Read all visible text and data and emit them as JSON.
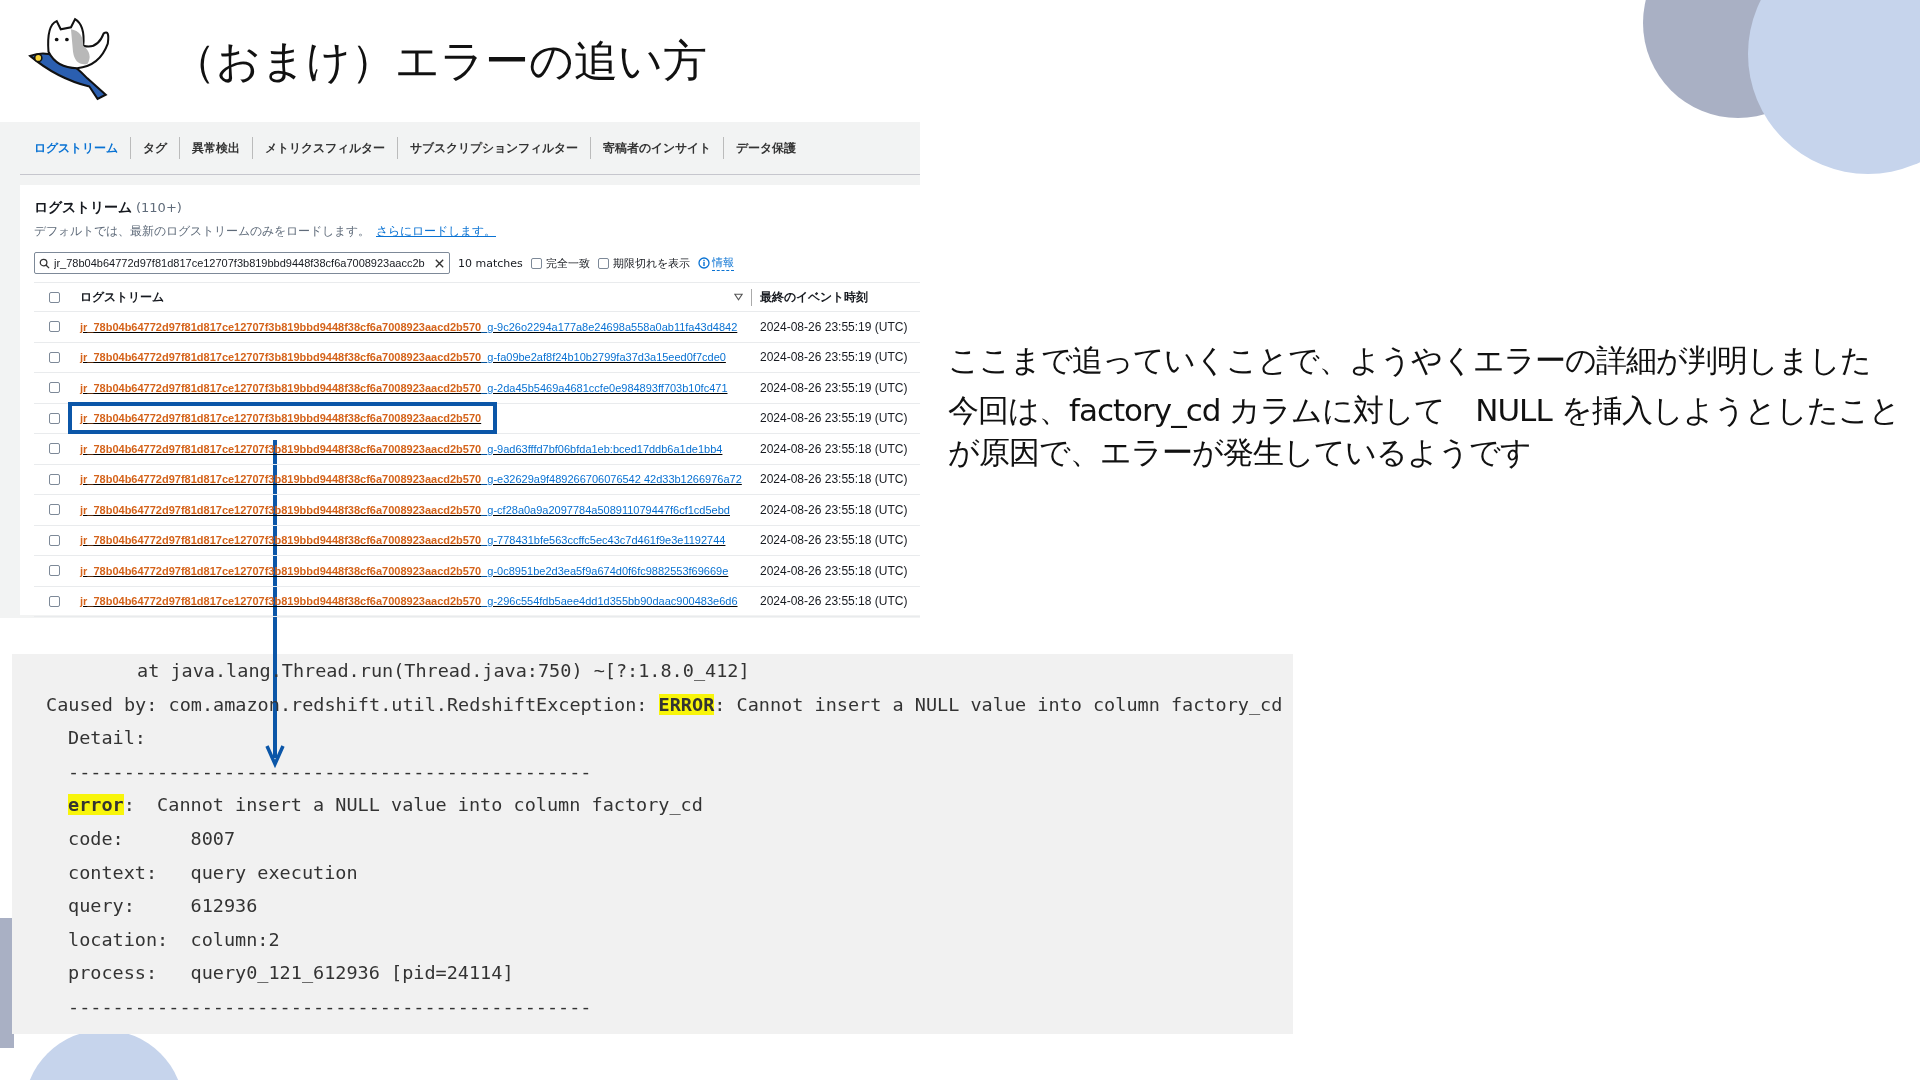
{
  "slide": {
    "title": "（おまけ）エラーの追い方"
  },
  "console": {
    "tabs": [
      {
        "label": "ログストリーム",
        "selected": true
      },
      {
        "label": "タグ",
        "selected": false
      },
      {
        "label": "異常検出",
        "selected": false
      },
      {
        "label": "メトリクスフィルター",
        "selected": false
      },
      {
        "label": "サブスクリプションフィルター",
        "selected": false
      },
      {
        "label": "寄稿者のインサイト",
        "selected": false
      },
      {
        "label": "データ保護",
        "selected": false
      }
    ],
    "panel_title": "ログストリーム",
    "count": "(110+)",
    "description": "デフォルトでは、最新のログストリームのみをロードします。",
    "load_more_link": "さらにロードします。",
    "search": {
      "value": "jr_78b04b64772d97f81d817ce12707f3b819bbd9448f38cf6a7008923aacc2b"
    },
    "matches": "10 matches",
    "options": [
      {
        "label": "完全一致",
        "checked": false
      },
      {
        "label": "期限切れを表示",
        "checked": false
      }
    ],
    "info_link": "情報",
    "select_all_checked": false,
    "columns": [
      "ログストリーム",
      "最終のイベント時刻"
    ],
    "rows": [
      {
        "prefix": "jr_78b04b64772d97f81d817ce12707f3b819bbd9448f38cf6a7008923aacd2b570",
        "suffix": "_g-9c26o2294a177a8e24698a558a0ab11fa43d4842",
        "time": "2024-08-26 23:55:19 (UTC)",
        "checked": false,
        "highlighted": false
      },
      {
        "prefix": "jr_78b04b64772d97f81d817ce12707f3b819bbd9448f38cf6a7008923aacd2b570",
        "suffix": "_g-fa09be2af8f24b10b2799fa37d3a15eed0f7cde0",
        "time": "2024-08-26 23:55:19 (UTC)",
        "checked": false,
        "highlighted": false
      },
      {
        "prefix": "jr_78b04b64772d97f81d817ce12707f3b819bbd9448f38cf6a7008923aacd2b570",
        "suffix": "_g-2da45b5469a4681ccfe0e984893ff703b10fc471",
        "time": "2024-08-26 23:55:19 (UTC)",
        "checked": false,
        "highlighted": false
      },
      {
        "prefix": "jr_78b04b64772d97f81d817ce12707f3b819bbd9448f38cf6a7008923aacd2b570",
        "time": "2024-08-26 23:55:19 (UTC)",
        "checked": false,
        "highlighted": true
      },
      {
        "prefix": "jr_78b04b64772d97f81d817ce12707f3b819bbd9448f38cf6a7008923aacd2b570",
        "suffix": "_g-9ad63fffd7bf06bfda1eb:bced17ddb6a1de1bb4",
        "time": "2024-08-26 23:55:18 (UTC)",
        "checked": false,
        "highlighted": false
      },
      {
        "prefix": "jr_78b04b64772d97f81d817ce12707f3b819bbd9448f38cf6a7008923aacd2b570",
        "suffix": "_g-e32629a9f489266706076542 42d33b1266976a72",
        "time": "2024-08-26 23:55:18 (UTC)",
        "checked": false,
        "highlighted": false
      },
      {
        "prefix": "jr_78b04b64772d97f81d817ce12707f3b819bbd9448f38cf6a7008923aacd2b570",
        "suffix": "_g-cf28a0a9a2097784a508911079447f6cf1cd5ebd",
        "time": "2024-08-26 23:55:18 (UTC)",
        "checked": false,
        "highlighted": false
      },
      {
        "prefix": "jr_78b04b64772d97f81d817ce12707f3b819bbd9448f38cf6a7008923aacd2b570",
        "suffix": "_g-778431bfe563ccffc5ec43c7d461f9e3e1192744",
        "time": "2024-08-26 23:55:18 (UTC)",
        "checked": false,
        "highlighted": false
      },
      {
        "prefix": "jr_78b04b64772d97f81d817ce12707f3b819bbd9448f38cf6a7008923aacd2b570",
        "suffix": "_g-0c8951be2d3ea5f9a674d0f6fc9882553f69669e",
        "time": "2024-08-26 23:55:18 (UTC)",
        "checked": false,
        "highlighted": false
      },
      {
        "prefix": "jr_78b04b64772d97f81d817ce12707f3b819bbd9448f38cf6a7008923aacd2b570",
        "suffix": "_g-296c554fdb5aee4dd1d355bb90daac900483e6d6",
        "time": "2024-08-26 23:55:18 (UTC)",
        "checked": false,
        "highlighted": false
      }
    ]
  },
  "explanation": [
    "ここまで追っていくことで、ようやくエラーの詳細が判明しました",
    "今回は、factory_cd カラムに対して　NULL を挿入しようとしたことが原因で、エラーが発生しているようです"
  ],
  "log": [
    {
      "kind": "trace",
      "parts": [
        {
          "text": "at java.lang.Thread.run(Thread.java:750) ~[?:1.8.0_412]",
          "highlight": false
        }
      ]
    },
    {
      "kind": "cause",
      "parts": [
        {
          "text": "Caused by: com.amazon.redshift.util.RedshiftException: ",
          "highlight": false
        },
        {
          "text": "ERROR",
          "highlight": true
        },
        {
          "text": ": Cannot insert a NULL value into column factory_cd",
          "highlight": false
        }
      ]
    },
    {
      "kind": "detail",
      "parts": [
        {
          "text": "Detail:",
          "highlight": false
        }
      ]
    },
    {
      "kind": "detail",
      "parts": [
        {
          "text": "-----------------------------------------------",
          "highlight": false
        }
      ]
    },
    {
      "kind": "detail",
      "parts": [
        {
          "text": "error",
          "highlight": true
        },
        {
          "text": ":  Cannot insert a NULL value into column factory_cd",
          "highlight": false
        }
      ]
    },
    {
      "kind": "detail",
      "parts": [
        {
          "text": "code:      8007",
          "highlight": false
        }
      ]
    },
    {
      "kind": "detail",
      "parts": [
        {
          "text": "context:   query execution",
          "highlight": false
        }
      ]
    },
    {
      "kind": "detail",
      "parts": [
        {
          "text": "query:     612936",
          "highlight": false
        }
      ]
    },
    {
      "kind": "detail",
      "parts": [
        {
          "text": "location:  column:2",
          "highlight": false
        }
      ]
    },
    {
      "kind": "detail",
      "parts": [
        {
          "text": "process:   query0_121_612936 [pid=24114]",
          "highlight": false
        }
      ]
    },
    {
      "kind": "detail",
      "parts": [
        {
          "text": "-----------------------------------------------",
          "highlight": false
        }
      ]
    }
  ]
}
